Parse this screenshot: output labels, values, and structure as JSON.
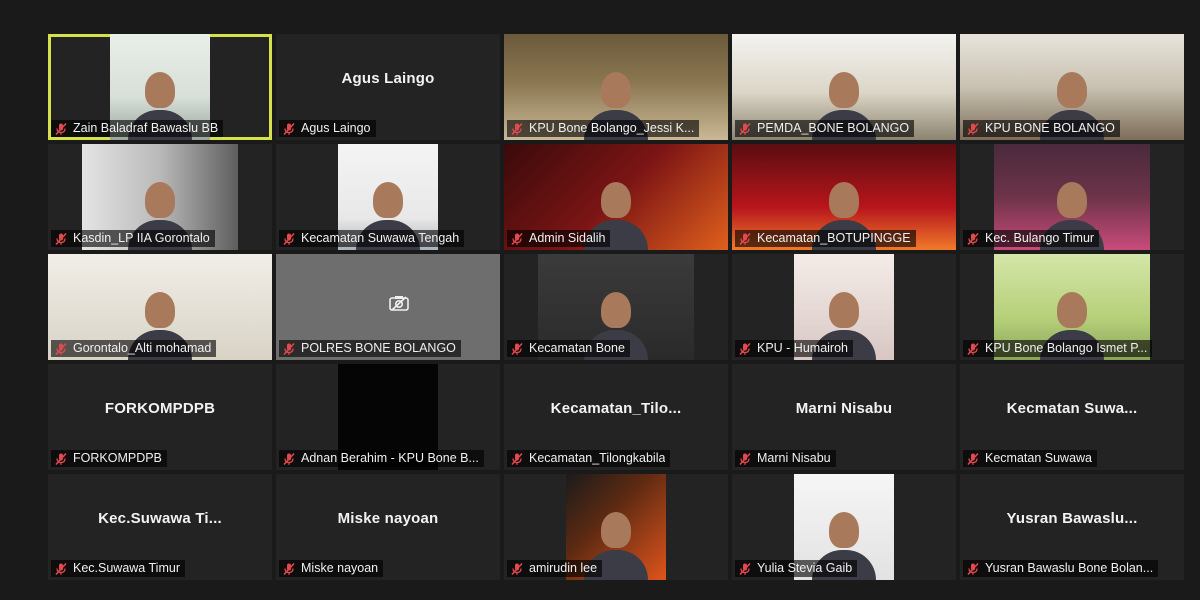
{
  "participants": [
    {
      "name": "Zain Baladraf Bawaslu BB",
      "display": "",
      "scene": "sc-office",
      "video": "mid",
      "active": true
    },
    {
      "name": "Agus Laingo",
      "display": "Agus Laingo",
      "scene": null,
      "video": null,
      "active": false
    },
    {
      "name": "KPU Bone Bolango_Jessi K...",
      "display": "",
      "scene": "sc-room",
      "video": "full",
      "active": false
    },
    {
      "name": "PEMDA_BONE BOLANGO",
      "display": "",
      "scene": "sc-hall",
      "video": "full",
      "active": false
    },
    {
      "name": "KPU BONE BOLANGO",
      "display": "",
      "scene": "sc-hall2",
      "video": "full",
      "active": false
    },
    {
      "name": "Kasdin_LP IIA Gorontalo",
      "display": "",
      "scene": "sc-wall",
      "video": "wide",
      "active": false
    },
    {
      "name": "Kecamatan Suwawa Tengah",
      "display": "",
      "scene": "sc-white",
      "video": "mid",
      "active": false
    },
    {
      "name": "Admin Sidalih",
      "display": "",
      "scene": "sc-red",
      "video": "full",
      "active": false
    },
    {
      "name": "Kecamatan_BOTUPINGGE",
      "display": "",
      "scene": "sc-red2",
      "video": "full",
      "active": false
    },
    {
      "name": "Kec. Bulango Timur",
      "display": "",
      "scene": "sc-purple",
      "video": "wide",
      "active": false
    },
    {
      "name": "Gorontalo_Alti mohamad",
      "display": "",
      "scene": "sc-beige",
      "video": "full",
      "active": false
    },
    {
      "name": "POLRES BONE BOLANGO",
      "display": "",
      "scene": "sc-gray",
      "video": "full",
      "active": false,
      "camera_off": true
    },
    {
      "name": "Kecamatan Bone",
      "display": "",
      "scene": "sc-dark",
      "video": "wide",
      "active": false
    },
    {
      "name": "KPU - Humairoh",
      "display": "",
      "scene": "sc-pink",
      "video": "mid",
      "active": false
    },
    {
      "name": "KPU Bone Bolango Ismet P...",
      "display": "",
      "scene": "sc-green",
      "video": "wide",
      "active": false
    },
    {
      "name": "FORKOMPDPB",
      "display": "FORKOMPDPB",
      "scene": null,
      "video": null,
      "active": false
    },
    {
      "name": "Adnan Berahim - KPU Bone B...",
      "display": "",
      "scene": "sc-black",
      "video": "mid",
      "active": false
    },
    {
      "name": "Kecamatan_Tilongkabila",
      "display": "Kecamatan_Tilo...",
      "scene": null,
      "video": null,
      "active": false
    },
    {
      "name": "Marni Nisabu",
      "display": "Marni Nisabu",
      "scene": null,
      "video": null,
      "active": false
    },
    {
      "name": "Kecmatan Suwawa",
      "display": "Kecmatan  Suwa...",
      "scene": null,
      "video": null,
      "active": false
    },
    {
      "name": "Kec.Suwawa Timur",
      "display": "Kec.Suwawa  Ti...",
      "scene": null,
      "video": null,
      "active": false
    },
    {
      "name": "Miske nayoan",
      "display": "Miske nayoan",
      "scene": null,
      "video": null,
      "active": false
    },
    {
      "name": "amirudin lee",
      "display": "",
      "scene": "sc-orange",
      "video": "mid",
      "active": false
    },
    {
      "name": "Yulia Stevia Gaib",
      "display": "",
      "scene": "sc-mosque",
      "video": "mid",
      "active": false
    },
    {
      "name": "Yusran Bawaslu Bone Bolan...",
      "display": "Yusran  Bawaslu...",
      "scene": null,
      "video": null,
      "active": false
    }
  ],
  "colors": {
    "background": "#1a1a1a",
    "tile": "#232323",
    "active_border": "#d6e24a",
    "muted_mic": "#e5484d"
  },
  "icons": {
    "mic": "muted-mic-icon",
    "camera": "camera-off-icon"
  }
}
